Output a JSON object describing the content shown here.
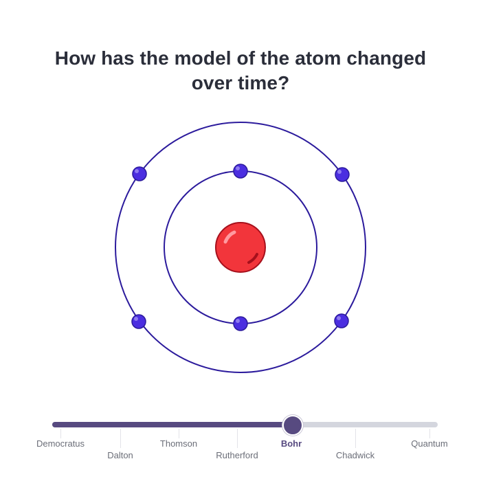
{
  "question": {
    "line1": "How has the model of the atom changed",
    "line2": "over time?"
  },
  "atom": {
    "nucleus_color": "#f2353b",
    "electron_color": "#4b2ee0",
    "orbit_color": "#2b1a9c",
    "inner_orbit_electrons": 2,
    "outer_orbit_electrons": 4
  },
  "timeline": {
    "selected_index": 4,
    "fill_color": "#574a80",
    "track_color": "#d4d6de",
    "stops": [
      {
        "label": "Democratus"
      },
      {
        "label": "Dalton"
      },
      {
        "label": "Thomson"
      },
      {
        "label": "Rutherford"
      },
      {
        "label": "Bohr"
      },
      {
        "label": "Chadwick"
      },
      {
        "label": "Quantum"
      }
    ]
  }
}
